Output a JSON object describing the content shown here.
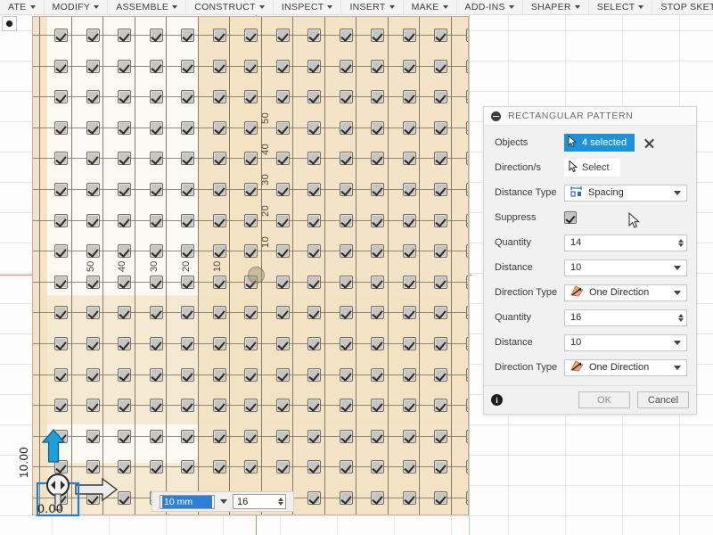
{
  "menubar": {
    "items": [
      {
        "label": "ATE",
        "caret": true
      },
      {
        "label": "MODIFY",
        "caret": true
      },
      {
        "label": "ASSEMBLE",
        "caret": true
      },
      {
        "label": "CONSTRUCT",
        "caret": true
      },
      {
        "label": "INSPECT",
        "caret": true
      },
      {
        "label": "INSERT",
        "caret": true
      },
      {
        "label": "MAKE",
        "caret": true
      },
      {
        "label": "ADD-INS",
        "caret": true
      },
      {
        "label": "SHAPER",
        "caret": true
      },
      {
        "label": "SELECT",
        "caret": true
      },
      {
        "label": "STOP SKETCH",
        "caret": true
      }
    ]
  },
  "corner_button": {
    "icon": "circle-dot-icon"
  },
  "panel": {
    "title": "RECTANGULAR PATTERN",
    "collapse_icon": "minus-circle-icon",
    "rows": [
      {
        "label": "Objects",
        "kind": "select-pill",
        "value": "4 selected",
        "icon": "cursor-arrow-icon",
        "close_icon": "close-icon"
      },
      {
        "label": "Direction/s",
        "kind": "select-plain",
        "value": "Select",
        "icon": "cursor-arrow-icon"
      },
      {
        "label": "Distance Type",
        "kind": "dropdown",
        "value": "Spacing",
        "icon": "spacing-icon"
      },
      {
        "label": "Suppress",
        "kind": "checkbox",
        "value": "",
        "icon": "checkbox-checked-icon",
        "checked": true
      },
      {
        "label": "Quantity",
        "kind": "spinner",
        "value": "14"
      },
      {
        "label": "Distance",
        "kind": "dropdown-value",
        "value": "10"
      },
      {
        "label": "Direction Type",
        "kind": "dropdown",
        "value": "One Direction",
        "icon": "one-direction-icon"
      },
      {
        "label": "Quantity",
        "kind": "spinner",
        "value": "16"
      },
      {
        "label": "Distance",
        "kind": "dropdown-value",
        "value": "10"
      },
      {
        "label": "Direction Type",
        "kind": "dropdown",
        "value": "One Direction",
        "icon": "one-direction-icon"
      }
    ],
    "footer": {
      "info_icon": "info-icon",
      "ok_label": "OK",
      "cancel_label": "Cancel"
    }
  },
  "dimension_toolbar": {
    "value": "10 mm",
    "value_selected": true,
    "unit_caret_icon": "chevron-down-icon",
    "count": "16",
    "spinner_icon": "spinner-arrows-icon"
  },
  "canvas": {
    "horizontal_dimension_labels": [
      "50",
      "40",
      "30",
      "20",
      "10"
    ],
    "vertical_dimension_labels": [
      "50",
      "40",
      "30",
      "20",
      "10"
    ],
    "origin_dimension_vertical": "10.00",
    "origin_dimension_horizontal": "0.00",
    "up_arrow_icon": "arrow-up-manipulator-icon",
    "right_arrow_icon": "arrow-right-manipulator-icon",
    "origin_handle_icon": "origin-move-handle-icon",
    "origin_point_icon": "origin-point-icon",
    "x_axis_color": "#e8807f",
    "y_axis_color": "#7fae6c",
    "pattern_cell_icon": "checkbox-checked-icon",
    "pattern_columns": 14,
    "pattern_rows": 16,
    "highlight_color": "#f3e2c3",
    "sketch_fill": "#fbf9f4"
  },
  "cursor": {
    "icon": "mouse-pointer-icon"
  }
}
